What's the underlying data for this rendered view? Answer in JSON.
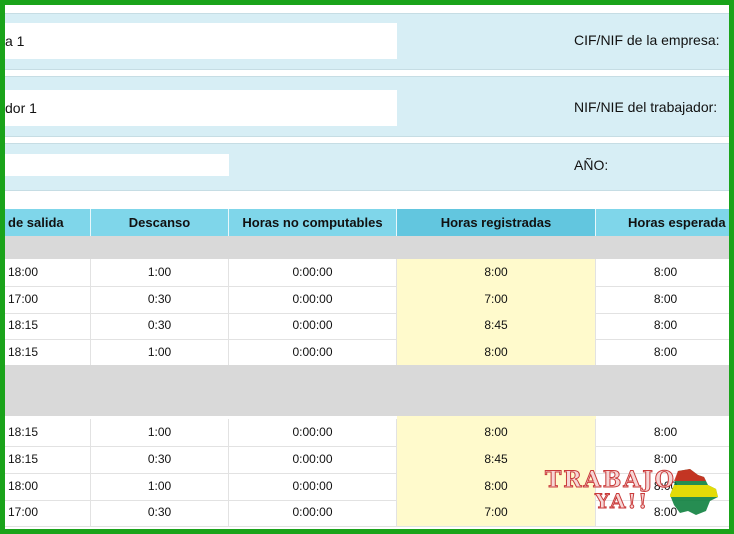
{
  "info": {
    "company_value": "a 1",
    "company_label": "CIF/NIF de la empresa:",
    "worker_value": "dor 1",
    "worker_label": "NIF/NIE del trabajador:",
    "year_value": "",
    "year_label": "AÑO:"
  },
  "table": {
    "headers": [
      "de salida",
      "Descanso",
      "Horas no computables",
      "Horas registradas",
      "Horas esperada"
    ],
    "group1": [
      [
        "18:00",
        "1:00",
        "0:00:00",
        "8:00",
        "8:00"
      ],
      [
        "17:00",
        "0:30",
        "0:00:00",
        "7:00",
        "8:00"
      ],
      [
        "18:15",
        "0:30",
        "0:00:00",
        "8:45",
        "8:00"
      ],
      [
        "18:15",
        "1:00",
        "0:00:00",
        "8:00",
        "8:00"
      ]
    ],
    "group2": [
      [
        "18:15",
        "1:00",
        "0:00:00",
        "8:00",
        "8:00"
      ],
      [
        "18:15",
        "0:30",
        "0:00:00",
        "8:45",
        "8:00"
      ],
      [
        "18:00",
        "1:00",
        "0:00:00",
        "8:00",
        "8:00"
      ],
      [
        "17:00",
        "0:30",
        "0:00:00",
        "7:00",
        "8:00"
      ]
    ]
  },
  "logo": {
    "line1": "TRABAJO",
    "line2": "YA!!",
    "flag_colors": [
      "#d52b1e",
      "#f9e300",
      "#007934"
    ]
  }
}
